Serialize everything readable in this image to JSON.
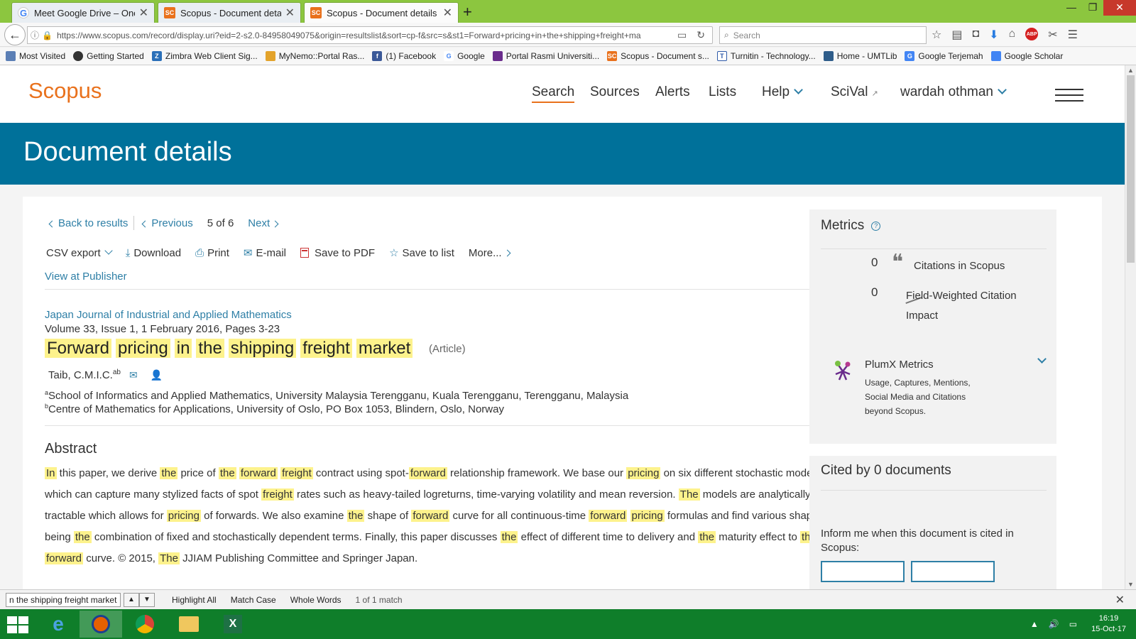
{
  "browser": {
    "tabs": [
      {
        "title": "Meet Google Drive – One pla",
        "favicon": "google-g-icon"
      },
      {
        "title": "Scopus - Document details",
        "favicon": "scopus-sc-icon"
      },
      {
        "title": "Scopus - Document details",
        "favicon": "scopus-sc-icon"
      }
    ],
    "url": "https://www.scopus.com/record/display.uri?eid=2-s2.0-84958049075&origin=resultslist&sort=cp-f&src=s&st1=Forward+pricing+in+the+shipping+freight+ma",
    "search_placeholder": "Search",
    "bookmarks": [
      "Most Visited",
      "Getting Started",
      "Zimbra Web Client Sig...",
      "MyNemo::Portal Ras...",
      "(1) Facebook",
      "Google",
      "Portal Rasmi Universiti...",
      "Scopus - Document s...",
      "Turnitin - Technology...",
      "Home - UMTLib",
      "Google Terjemah",
      "Google Scholar"
    ]
  },
  "site": {
    "logo": "Scopus",
    "nav": {
      "search": "Search",
      "sources": "Sources",
      "alerts": "Alerts",
      "lists": "Lists",
      "help": "Help",
      "scival": "SciVal",
      "user": "wardah othman"
    },
    "banner_title": "Document details"
  },
  "doc_nav": {
    "back": "Back to results",
    "previous": "Previous",
    "position": "5",
    "of": "of",
    "total": "6",
    "next": "Next"
  },
  "actions": {
    "csv": "CSV export",
    "download": "Download",
    "print": "Print",
    "email": "E-mail",
    "pdf": "Save to PDF",
    "list": "Save to list",
    "more": "More...",
    "publisher": "View at Publisher"
  },
  "document": {
    "journal": "Japan Journal of Industrial and Applied Mathematics",
    "volume": "Volume 33, Issue 1, 1 February 2016, Pages 3-23",
    "title_words": [
      "Forward",
      "pricing",
      "in",
      "the",
      "shipping",
      "freight",
      "market"
    ],
    "doc_type": "(Article)",
    "author": "Taib, C.M.I.C.",
    "author_sup": "ab",
    "affiliations": [
      {
        "sup": "a",
        "text": "School of Informatics and Applied Mathematics, University Malaysia Terengganu, Kuala Terengganu, Terengganu, Malaysia"
      },
      {
        "sup": "b",
        "text": "Centre of Mathematics for Applications, University of Oslo, PO Box 1053, Blindern, Oslo, Norway"
      }
    ],
    "abstract_heading": "Abstract",
    "abstract_segments": [
      {
        "t": "In",
        "h": true
      },
      {
        "t": " this paper, we derive ",
        "h": false
      },
      {
        "t": "the",
        "h": true
      },
      {
        "t": " price of ",
        "h": false
      },
      {
        "t": "the",
        "h": true
      },
      {
        "t": " ",
        "h": false
      },
      {
        "t": "forward",
        "h": true
      },
      {
        "t": " ",
        "h": false
      },
      {
        "t": "freight",
        "h": true
      },
      {
        "t": " contract using spot-",
        "h": false
      },
      {
        "t": "forward",
        "h": true
      },
      {
        "t": " relationship framework. We base our ",
        "h": false
      },
      {
        "t": "pricing",
        "h": true
      },
      {
        "t": " on six different stochastic models which can capture many stylized facts of spot ",
        "h": false
      },
      {
        "t": "freight",
        "h": true
      },
      {
        "t": " rates such as heavy-tailed logreturns, time-varying volatility and mean reversion. ",
        "h": false
      },
      {
        "t": "The",
        "h": true
      },
      {
        "t": " models are analytically tractable which allows for ",
        "h": false
      },
      {
        "t": "pricing",
        "h": true
      },
      {
        "t": " of forwards. We also examine ",
        "h": false
      },
      {
        "t": "the",
        "h": true
      },
      {
        "t": " shape of ",
        "h": false
      },
      {
        "t": "forward",
        "h": true
      },
      {
        "t": " curve for all continuous-time ",
        "h": false
      },
      {
        "t": "forward",
        "h": true
      },
      {
        "t": " ",
        "h": false
      },
      {
        "t": "pricing",
        "h": true
      },
      {
        "t": " formulas and find various shapes being ",
        "h": false
      },
      {
        "t": "the",
        "h": true
      },
      {
        "t": " combination of fixed and stochastically dependent terms. Finally, this paper discusses ",
        "h": false
      },
      {
        "t": "the",
        "h": true
      },
      {
        "t": " effect of different time to delivery and ",
        "h": false
      },
      {
        "t": "the",
        "h": true
      },
      {
        "t": " maturity effect to ",
        "h": false
      },
      {
        "t": "the",
        "h": true
      },
      {
        "t": " ",
        "h": false
      },
      {
        "t": "forward",
        "h": true
      },
      {
        "t": " curve. © 2015, ",
        "h": false
      },
      {
        "t": "The",
        "h": true
      },
      {
        "t": " JJIAM Publishing Committee and Springer Japan.",
        "h": false
      }
    ]
  },
  "metrics": {
    "heading": "Metrics",
    "citations_value": "0",
    "citations_label": "Citations in Scopus",
    "fwci_value": "0",
    "fwci_label_1": "Field-Weighted Citation",
    "fwci_label_2": "Impact",
    "plumx_heading": "PlumX Metrics",
    "plumx_lines": [
      "Usage, Captures, Mentions,",
      "Social Media and Citations",
      "beyond Scopus."
    ]
  },
  "cited": {
    "heading": "Cited by 0 documents",
    "inform": "Inform me when this document is cited in Scopus:"
  },
  "findbar": {
    "query": "n the shipping freight market",
    "highlight_all": "Highlight All",
    "match_case": "Match Case",
    "whole_words": "Whole Words",
    "count": "1 of 1 match"
  },
  "taskbar": {
    "time": "16:19",
    "date": "15-Oct-17"
  },
  "colors": {
    "accent": "#e9711c",
    "banner": "#00719a",
    "link": "#2e7fa6",
    "highlight": "#fdf28c",
    "tabbar": "#8cc63f",
    "taskbar": "#0f7e2a"
  }
}
